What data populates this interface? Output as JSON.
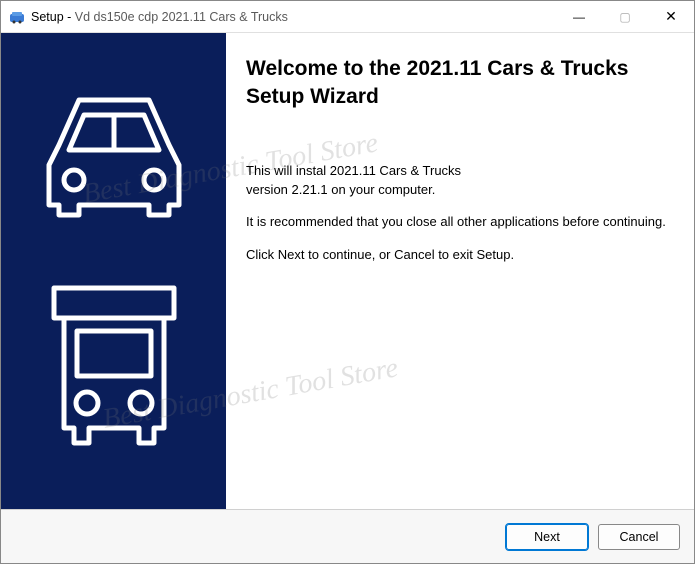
{
  "titlebar": {
    "prefix": "Setup - ",
    "appname": "Vd ds150e cdp 2021.11 Cars & Trucks",
    "minimize": "—",
    "maximize": "▢",
    "close": "✕"
  },
  "watermark": "Best Diagnostic Tool Store",
  "heading": "Welcome to the 2021.11 Cars & Trucks Setup Wizard",
  "body": {
    "line1": "This will instal 2021.11 Cars & Trucks",
    "line2": "version 2.21.1 on your computer.",
    "line3": "It is recommended that you close all other applications before continuing.",
    "line4": "Click Next to continue, or Cancel to exit Setup."
  },
  "footer": {
    "next": "Next",
    "cancel": "Cancel"
  }
}
